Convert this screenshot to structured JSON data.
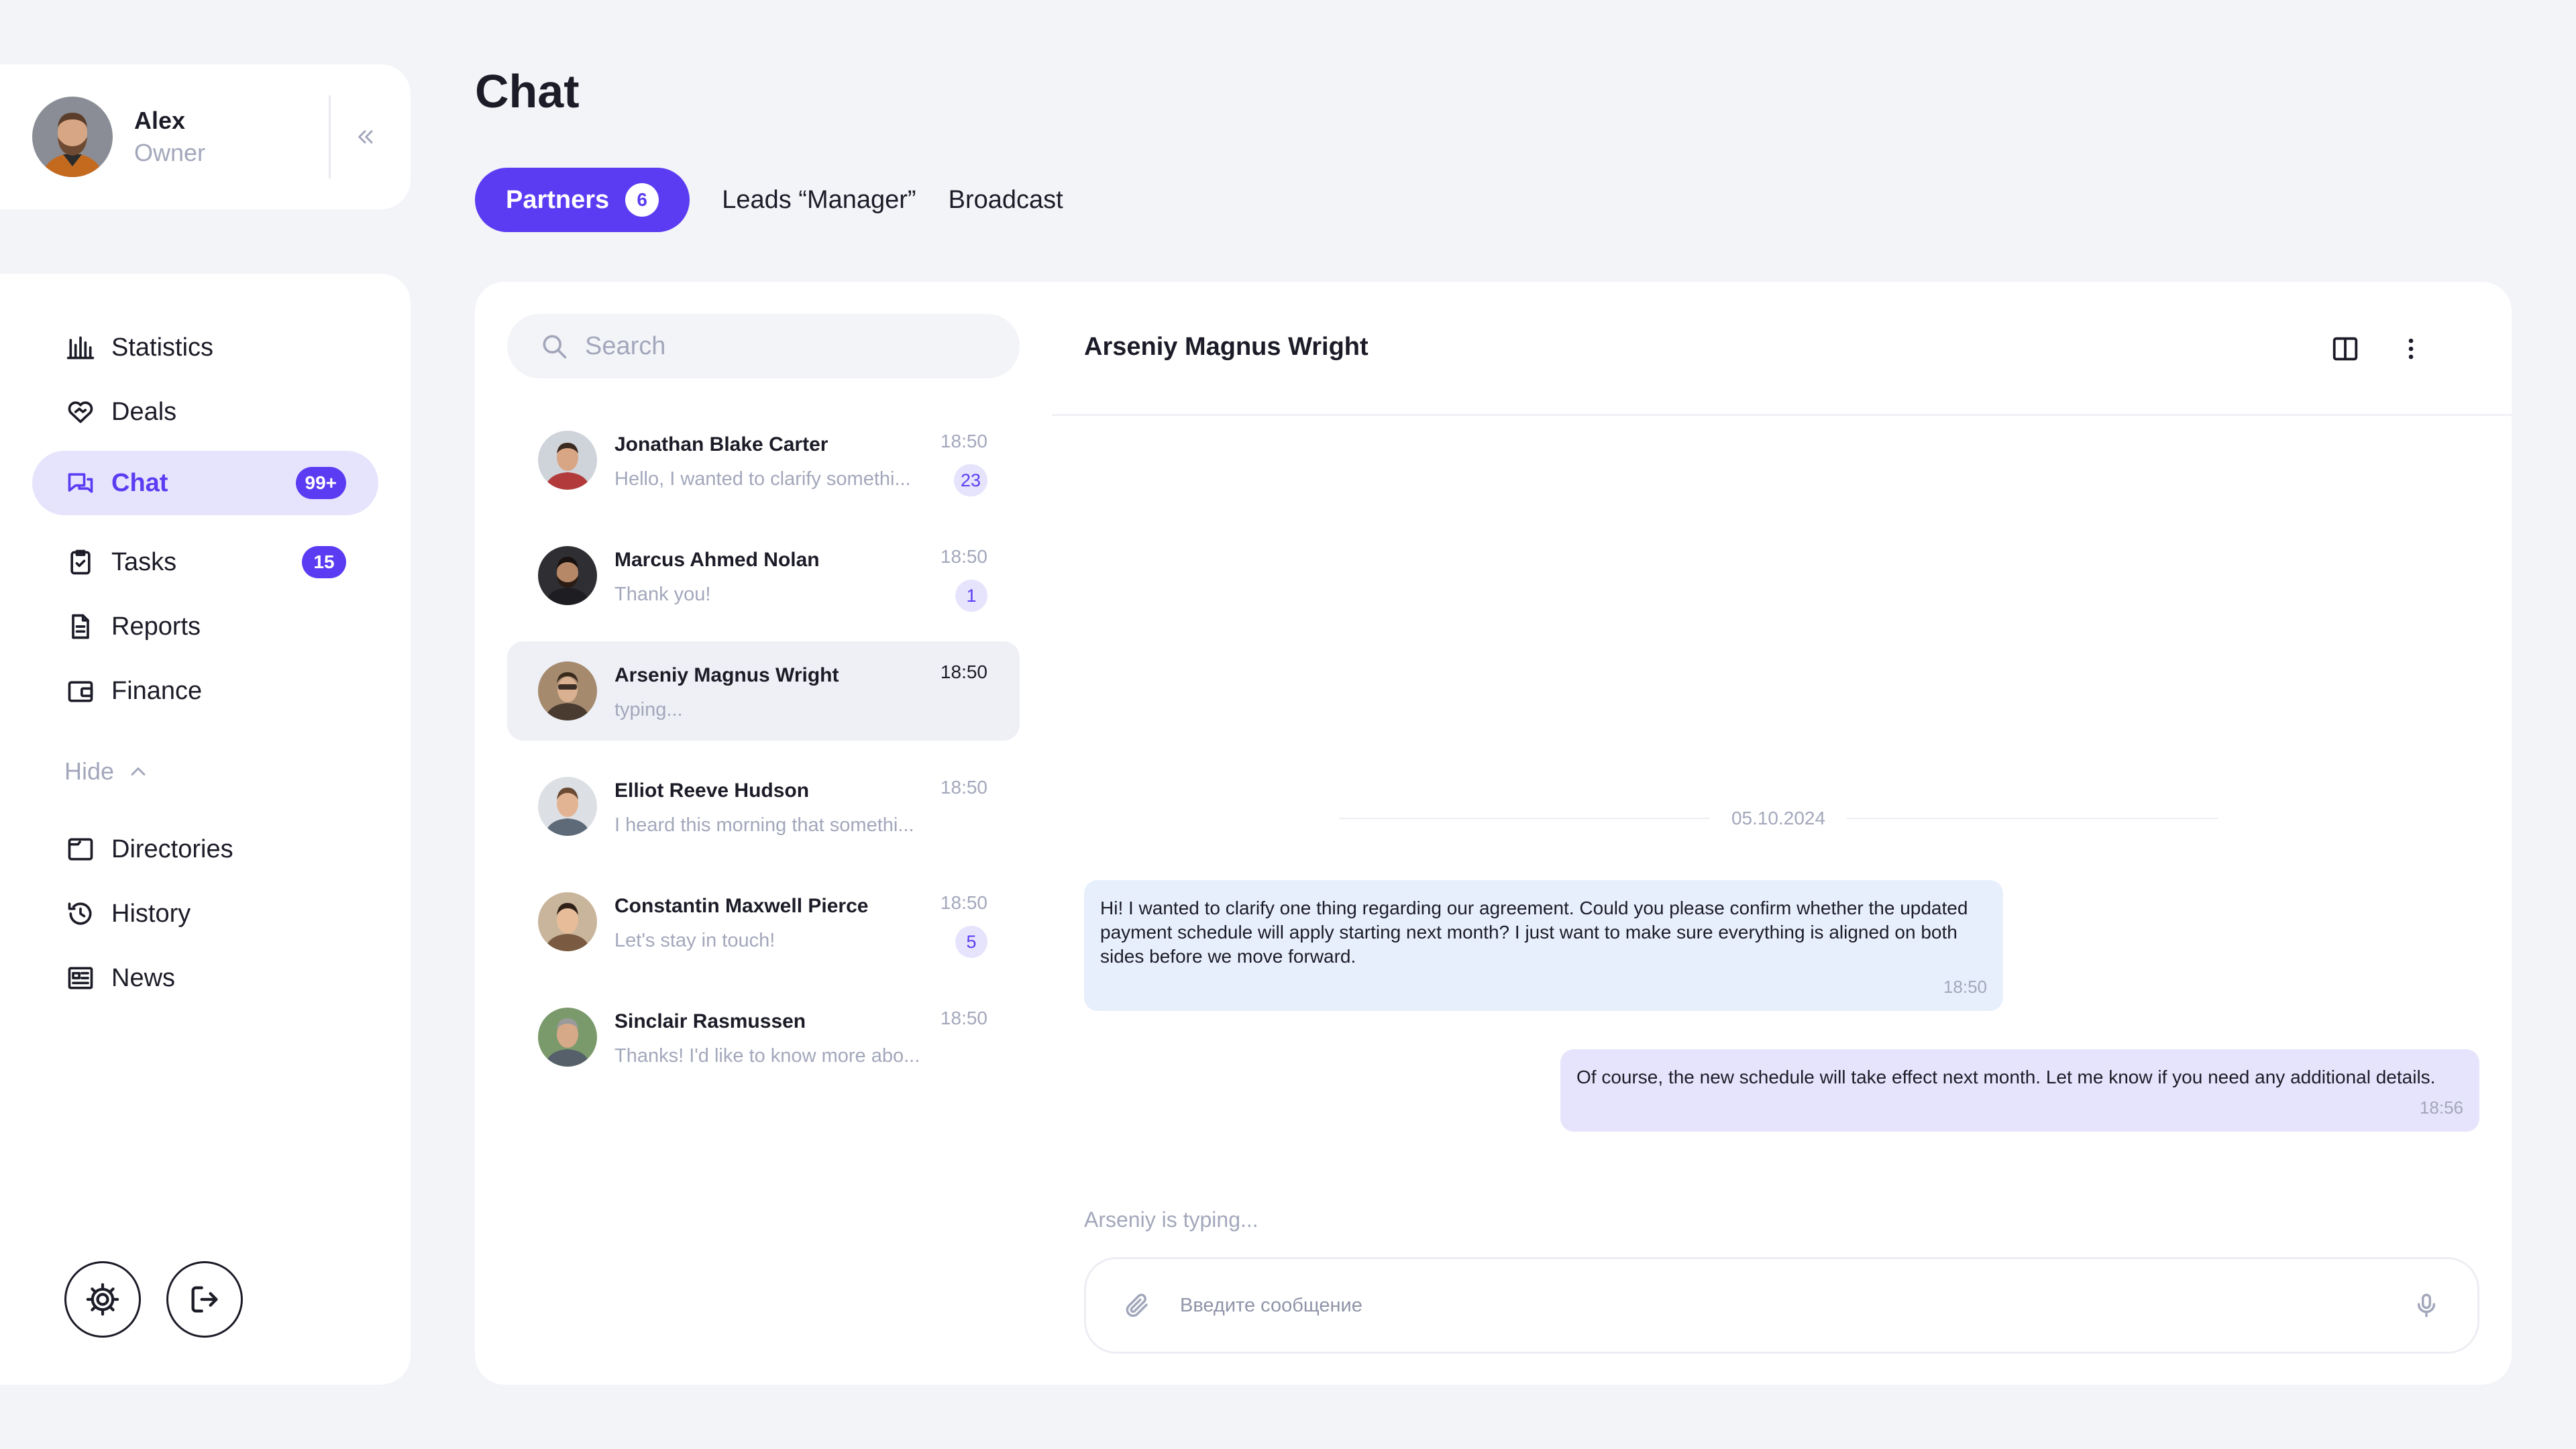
{
  "profile": {
    "name": "Alex",
    "role": "Owner"
  },
  "nav": {
    "primary": [
      {
        "id": "statistics",
        "label": "Statistics",
        "icon": "bar-chart-icon"
      },
      {
        "id": "deals",
        "label": "Deals",
        "icon": "handshake-heart-icon"
      },
      {
        "id": "chat",
        "label": "Chat",
        "icon": "chat-bubbles-icon",
        "badge": "99+",
        "active": true
      },
      {
        "id": "tasks",
        "label": "Tasks",
        "icon": "clipboard-check-icon",
        "badge": "15"
      },
      {
        "id": "reports",
        "label": "Reports",
        "icon": "document-icon"
      },
      {
        "id": "finance",
        "label": "Finance",
        "icon": "wallet-icon"
      }
    ],
    "hide_label": "Hide",
    "secondary": [
      {
        "id": "directories",
        "label": "Directories",
        "icon": "folder-icon"
      },
      {
        "id": "history",
        "label": "History",
        "icon": "history-icon"
      },
      {
        "id": "news",
        "label": "News",
        "icon": "newspaper-icon"
      }
    ]
  },
  "header": {
    "title": "Chat",
    "tabs": [
      {
        "label": "Partners",
        "badge": "6",
        "active": true
      },
      {
        "label": "Leads “Manager”"
      },
      {
        "label": "Broadcast"
      }
    ]
  },
  "search": {
    "placeholder": "Search"
  },
  "conversations": [
    {
      "name": "Jonathan Blake Carter",
      "preview": "Hello, I wanted to clarify somethi...",
      "time": "18:50",
      "unread": "23"
    },
    {
      "name": "Marcus Ahmed Nolan",
      "preview": "Thank you!",
      "time": "18:50",
      "unread": "1"
    },
    {
      "name": "Arseniy Magnus Wright",
      "preview": "typing...",
      "time": "18:50",
      "selected": true
    },
    {
      "name": "Elliot Reeve Hudson",
      "preview": "I heard this morning that somethi...",
      "time": "18:50"
    },
    {
      "name": "Constantin Maxwell Pierce",
      "preview": "Let's stay in touch!",
      "time": "18:50",
      "unread": "5"
    },
    {
      "name": "Sinclair Rasmussen",
      "preview": "Thanks! I'd like to know more abo...",
      "time": "18:50"
    }
  ],
  "thread": {
    "title": "Arseniy Magnus Wright",
    "date": "05.10.2024",
    "messages": [
      {
        "direction": "incoming",
        "text": "Hi! I wanted to clarify one thing regarding our agreement. Could you please confirm whether the updated payment schedule will apply starting next month? I just want to make sure everything is aligned on both sides before we move forward.",
        "time": "18:50"
      },
      {
        "direction": "outgoing",
        "text": "Of course, the new schedule will take effect next month. Let me know if you need any additional details.",
        "time": "18:56"
      }
    ],
    "typing": "Arseniy is typing...",
    "composer_placeholder": "Введите сообщение"
  },
  "colors": {
    "accent": "#5b3cf2",
    "accent_soft": "#e6e4fc",
    "incoming_bubble": "#e7effc",
    "muted": "#a3a7bb"
  }
}
